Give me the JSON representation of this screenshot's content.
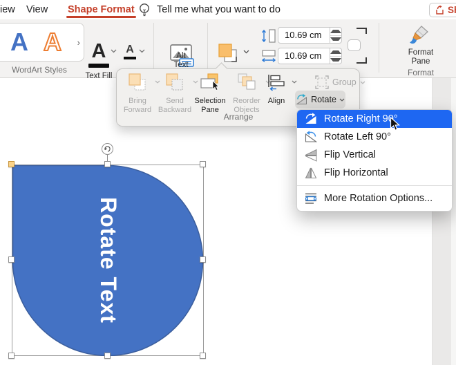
{
  "menubar": {
    "tab_partial": "iew",
    "tab_view": "View",
    "tab_shape_format": "Shape Format",
    "tell_me": "Tell me what you want to do",
    "share": "Sh"
  },
  "ribbon": {
    "wordart_styles_label": "WordArt Styles",
    "wordart_sample_1": "A",
    "wordart_sample_2": "A",
    "wordart_more": "›",
    "text_fill_sample": "A",
    "text_outline_sample": "A",
    "text_effects_sample": "A",
    "text_fill": "Text Fill",
    "alt_text": "Alt Text",
    "arrange": "Arrange",
    "height_value": "10.69 cm",
    "width_value": "10.69 cm",
    "format_pane": "Format Pane",
    "format_label": "Format"
  },
  "arrange_panel": {
    "bring_forward": "Bring Forward",
    "send_backward": "Send Backward",
    "selection_pane": "Selection Pane",
    "reorder_objects": "Reorder Objects",
    "align": "Align",
    "group": "Group",
    "rotate": "Rotate",
    "group_label": "Arrange"
  },
  "rotate_menu": {
    "items": [
      {
        "label": "Rotate Right 90°",
        "selected": true
      },
      {
        "label": "Rotate Left 90°",
        "selected": false
      },
      {
        "label": "Flip Vertical",
        "selected": false
      },
      {
        "label": "Flip Horizontal",
        "selected": false
      },
      {
        "label": "More Rotation Options...",
        "selected": false
      }
    ]
  },
  "shape": {
    "text": "Rotate Text",
    "fill_color": "#4472C4"
  },
  "colors": {
    "accent_red": "#C5402A",
    "selection_blue": "#1E67F2",
    "office_orange": "#ED7D31",
    "shape_blue": "#4472C4"
  }
}
